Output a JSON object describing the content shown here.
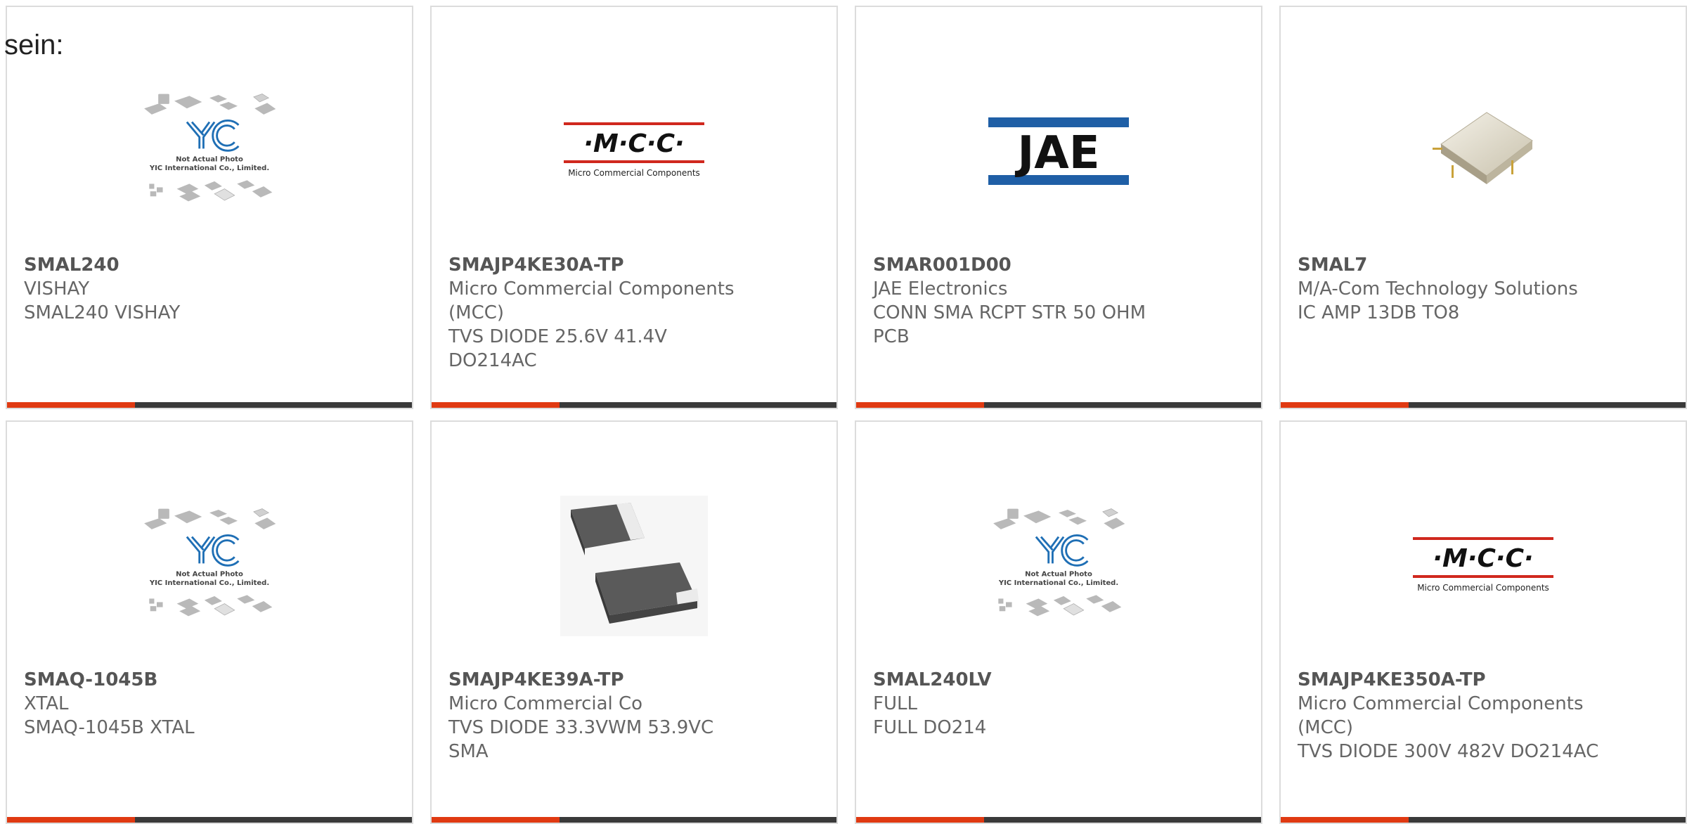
{
  "prefix_text": "sein:",
  "cards": [
    {
      "part_number": "SMAL240",
      "lines": [
        "VISHAY",
        "SMAL240 VISHAY"
      ],
      "image": "yic-placeholder",
      "image_caption_1": "Not Actual Photo",
      "image_caption_2": "YIC International Co., Limited."
    },
    {
      "part_number": "SMAJP4KE30A-TP",
      "lines": [
        "Micro Commercial Components",
        "(MCC)",
        "TVS DIODE 25.6V 41.4V",
        "DO214AC"
      ],
      "image": "mcc-logo",
      "logo_text": "·M·C·C·",
      "logo_sub": "Micro Commercial Components"
    },
    {
      "part_number": "SMAR001D00",
      "lines": [
        "JAE Electronics",
        "CONN SMA RCPT STR 50 OHM",
        "PCB"
      ],
      "image": "jae-logo",
      "logo_text": "JAE"
    },
    {
      "part_number": "SMAL7",
      "lines": [
        "M/A-Com Technology Solutions",
        "IC AMP 13DB TO8"
      ],
      "image": "metal-package"
    },
    {
      "part_number": "SMAQ-1045B",
      "lines": [
        "XTAL",
        "SMAQ-1045B XTAL"
      ],
      "image": "yic-placeholder",
      "image_caption_1": "Not Actual Photo",
      "image_caption_2": "YIC International Co., Limited."
    },
    {
      "part_number": "SMAJP4KE39A-TP",
      "lines": [
        "Micro Commercial Co",
        "TVS DIODE 33.3VWM 53.9VC",
        "SMA"
      ],
      "image": "sma-diode"
    },
    {
      "part_number": "SMAL240LV",
      "lines": [
        "FULL",
        "FULL DO214"
      ],
      "image": "yic-placeholder",
      "image_caption_1": "Not Actual Photo",
      "image_caption_2": "YIC International Co., Limited."
    },
    {
      "part_number": "SMAJP4KE350A-TP",
      "lines": [
        "Micro Commercial Components",
        "(MCC)",
        "TVS DIODE 300V 482V DO214AC"
      ],
      "image": "mcc-logo",
      "logo_text": "·M·C·C·",
      "logo_sub": "Micro Commercial Components"
    }
  ],
  "colors": {
    "accent": "#e03a12",
    "bar": "#3a3a3a",
    "border": "#dcdcdc",
    "yic_blue": "#1f6fb5",
    "mcc_red": "#d0281e",
    "jae_blue": "#1f5fa6"
  }
}
